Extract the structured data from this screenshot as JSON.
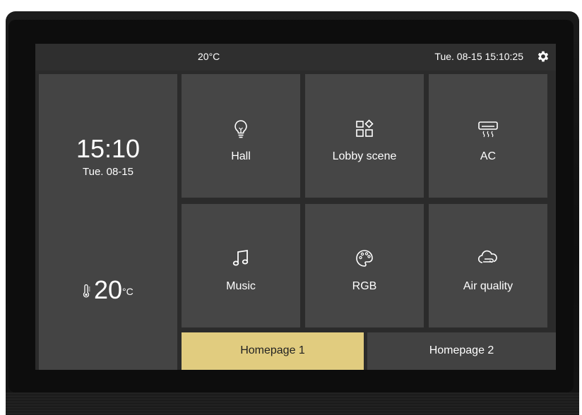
{
  "status_bar": {
    "temperature": "20°C",
    "datetime": "Tue. 08-15 15:10:25",
    "settings_icon": "gear-icon"
  },
  "info_panel": {
    "time": "15:10",
    "date": "Tue. 08-15",
    "room_temperature": "20",
    "temperature_unit": "°C",
    "temperature_icon": "thermometer-icon"
  },
  "tiles": [
    {
      "label": "Hall",
      "icon": "lightbulb-icon"
    },
    {
      "label": "Lobby scene",
      "icon": "scene-grid-icon"
    },
    {
      "label": "AC",
      "icon": "air-conditioner-icon"
    },
    {
      "label": "Music",
      "icon": "music-note-icon"
    },
    {
      "label": "RGB",
      "icon": "palette-icon"
    },
    {
      "label": "Air quality",
      "icon": "cloud-wind-icon"
    }
  ],
  "pages": [
    {
      "label": "Homepage 1",
      "active": true
    },
    {
      "label": "Homepage 2",
      "active": false
    }
  ],
  "colors": {
    "active_tab": "#e1cc7f",
    "tile": "#464646",
    "background": "#2b2b2b"
  }
}
